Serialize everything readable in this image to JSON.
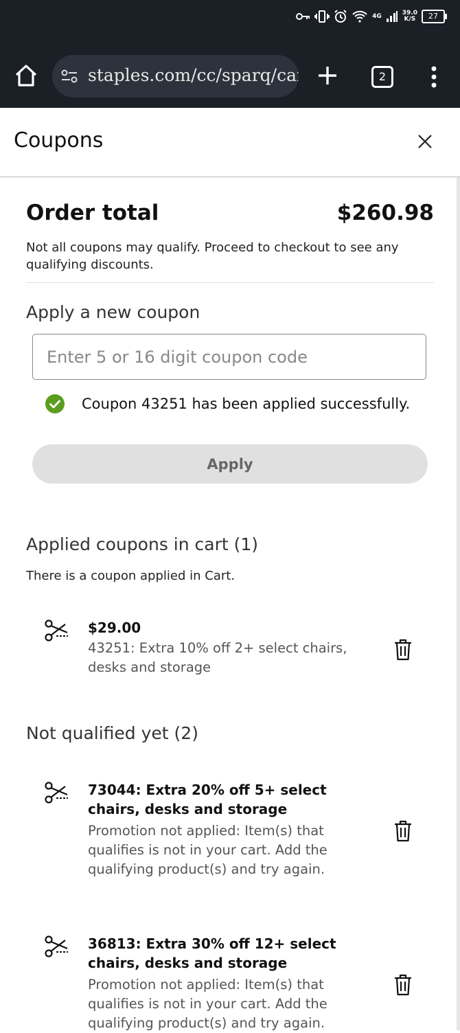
{
  "status_bar": {
    "network": "4G",
    "speed_value": "39.0",
    "speed_unit": "K/S",
    "battery": "27"
  },
  "browser": {
    "url": "staples.com/cc/sparq/cart",
    "tab_count": "2"
  },
  "sheet": {
    "title": "Coupons"
  },
  "order": {
    "label": "Order total",
    "amount": "$260.98",
    "note": "Not all coupons may qualify. Proceed to checkout to see any qualifying discounts."
  },
  "apply_section": {
    "heading": "Apply a new coupon",
    "placeholder": "Enter 5 or 16 digit coupon code",
    "success_message": "Coupon 43251 has been applied successfully.",
    "button_label": "Apply"
  },
  "applied": {
    "heading": "Applied coupons in cart (1)",
    "subtext": "There is a coupon applied in Cart.",
    "items": [
      {
        "amount": "$29.00",
        "description": "43251: Extra 10% off 2+ select chairs, desks and storage"
      }
    ]
  },
  "not_qualified": {
    "heading": "Not qualified yet (2)",
    "items": [
      {
        "title": "73044: Extra 20% off 5+ select chairs, desks and storage",
        "description": "Promotion not applied: Item(s) that qualifies is not in your cart. Add the qualifying product(s) and try again."
      },
      {
        "title": "36813: Extra 30% off 12+ select chairs, desks and storage",
        "description": "Promotion not applied: Item(s) that qualifies is not in your cart. Add the qualifying product(s) and try again."
      }
    ]
  },
  "colors": {
    "success_green": "#5a9e1e",
    "browser_bg": "#1b1f26"
  }
}
